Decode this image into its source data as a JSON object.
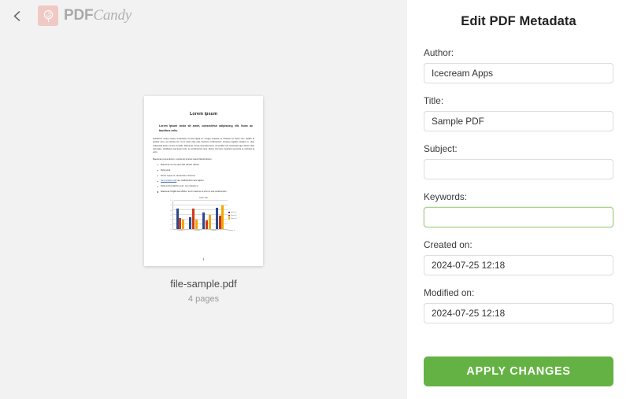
{
  "topbar": {
    "back_icon": "chevron-left-icon",
    "brand_pdf": "PDF",
    "brand_candy": "Candy",
    "brand_mark_icon": "lollipop-icon",
    "brand_mark_color": "#f0a9a0"
  },
  "document": {
    "file_name": "file-sample.pdf",
    "page_count_label": "4 pages",
    "preview": {
      "title": "Lorem ipsum",
      "lead": "Lorem Ipsum dolor sit amet, consectetur adipiscing elit. Nunc ac faucibus odio.",
      "paragraph1": "Vestibulum neque massa, scelerisque sit amet ligula eu, congue molestie mi. Praesent ut varius sem. Nullam at porttitor arcu, nec lacinia nisi. Ut ac dolor vitae odio interdum condimentum. Vivamus dapibus sodales ex, vitae malesuada ipsum cursus convallis. Maecenas cursus venenatis lacus, vel porttitor nisl consequat eget. Donec vitae velit tellus. Vestibulum sed ipsum felis, ac condimentum ante. Donec nisl risus, hendrerit sed porta ut, tincidunt at enim.",
      "paragraph2": "Maecenas cursus dictum, a porta dui sit amet mauris blandit dictum.",
      "list": [
        "Maecenas non leo quis nibh ultricies ultrices.",
        "Nulla porta.",
        "Donec neque mi, elementum a rhoncus.",
        "Nunc et lacus velit. Donec ut nibh a magna pulvinar blandit nec condimentum arcu sapien.",
        "Nulla viverra dapibus enim, nec molestie ut.",
        "Maecenas fringilla sed efficitur, leo in maximus ut enim in erat condimentum."
      ],
      "link_text": "Nunc et lacus velit",
      "page_marker": "1"
    },
    "chart_data": {
      "type": "bar",
      "title": "Chart Title",
      "categories": [
        "Category 1",
        "Category 2",
        "Category 3",
        "Category 4"
      ],
      "series": [
        {
          "name": "Series 1",
          "color": "#2d4b8e",
          "values": [
            4.3,
            2.5,
            3.5,
            4.5
          ]
        },
        {
          "name": "Series 2",
          "color": "#d03a1b",
          "values": [
            2.4,
            4.4,
            1.8,
            2.8
          ]
        },
        {
          "name": "Series 3",
          "color": "#f2a900",
          "values": [
            2.0,
            2.0,
            3.0,
            5.0
          ]
        }
      ],
      "ylim": [
        0,
        6
      ],
      "yticks": [
        "0",
        "1",
        "2",
        "3",
        "4",
        "5",
        "6"
      ],
      "grid": true,
      "legend_position": "right",
      "xlabel": "",
      "ylabel": ""
    }
  },
  "panel": {
    "title": "Edit PDF Metadata",
    "fields": [
      {
        "label": "Author:",
        "value": "Icecream Apps",
        "placeholder": "",
        "focused": false
      },
      {
        "label": "Title:",
        "value": "Sample PDF",
        "placeholder": "",
        "focused": false
      },
      {
        "label": "Subject:",
        "value": "",
        "placeholder": "",
        "focused": false
      },
      {
        "label": "Keywords:",
        "value": "",
        "placeholder": "",
        "focused": true
      },
      {
        "label": "Created on:",
        "value": "2024-07-25 12:18",
        "placeholder": "",
        "focused": false
      },
      {
        "label": "Modified on:",
        "value": "2024-07-25 12:18",
        "placeholder": "",
        "focused": false
      }
    ],
    "apply_label": "APPLY CHANGES",
    "accent_color": "#64b243",
    "focus_border_color": "#a4ce85"
  }
}
